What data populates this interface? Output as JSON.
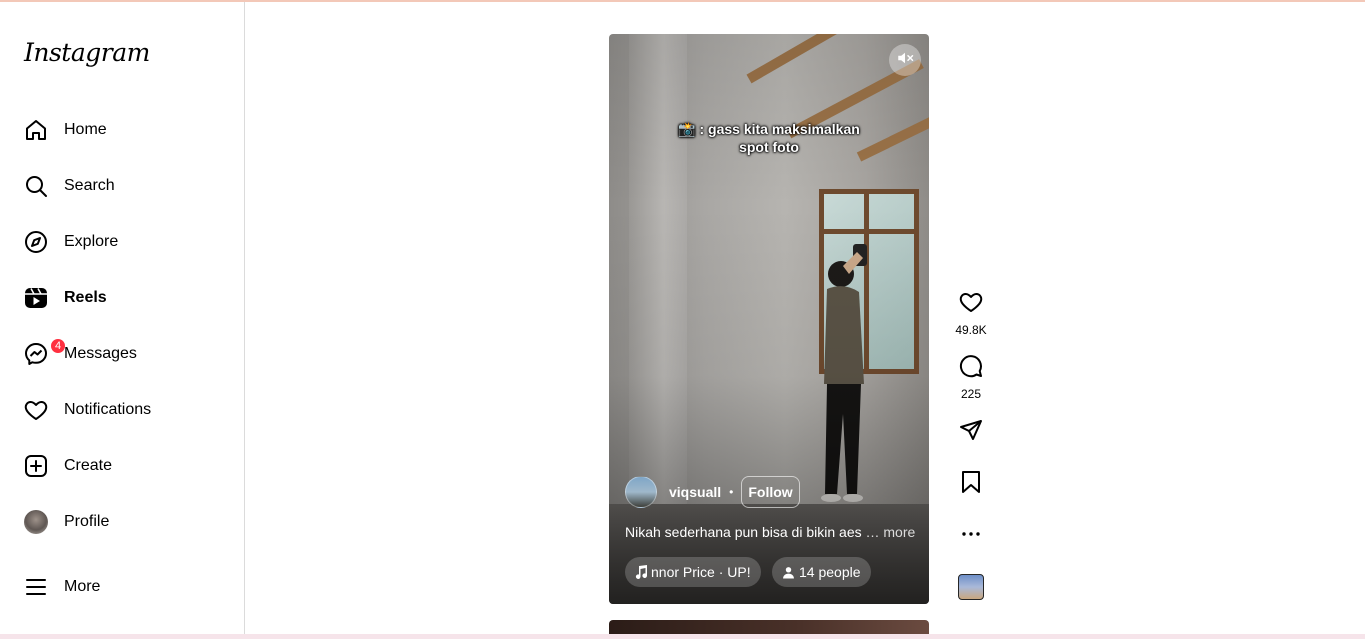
{
  "app": {
    "logo_text": "Instagram"
  },
  "sidebar": {
    "items": [
      {
        "label": "Home",
        "icon": "home-icon"
      },
      {
        "label": "Search",
        "icon": "search-icon"
      },
      {
        "label": "Explore",
        "icon": "compass-icon"
      },
      {
        "label": "Reels",
        "icon": "reels-icon",
        "active": true
      },
      {
        "label": "Messages",
        "icon": "messenger-icon",
        "badge": "4"
      },
      {
        "label": "Notifications",
        "icon": "heart-icon"
      },
      {
        "label": "Create",
        "icon": "plus-square-icon"
      },
      {
        "label": "Profile",
        "icon": "avatar"
      },
      {
        "label": "More",
        "icon": "menu-icon"
      }
    ]
  },
  "reel": {
    "overlay_text_line1": "📸 : gass kita maksimalkan",
    "overlay_text_line2": "spot foto",
    "author": "viqsuall",
    "follow_label": "Follow",
    "description": "Nikah sederhana pun bisa di bikin aes",
    "more_label": "… more",
    "audio_label": "nnor Price · UP!",
    "people_label": "14 people",
    "muted": true
  },
  "actions": {
    "likes": "49.8K",
    "comments": "225"
  },
  "colors": {
    "badge": "#ff3040",
    "border": "#dbdbdb",
    "text": "#000000"
  }
}
